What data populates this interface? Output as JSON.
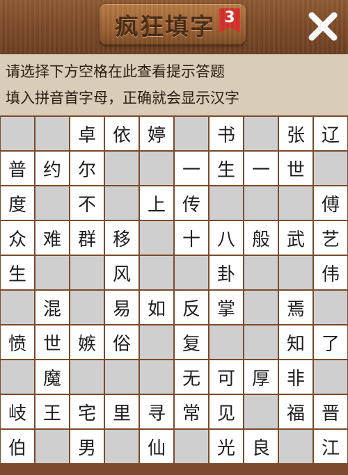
{
  "header": {
    "title": "疯狂填字",
    "level": "3"
  },
  "hints": {
    "line1": "请选择下方空格在此查看提示答题",
    "line2": "填入拼音首字母，正确就会显示汉字"
  },
  "colors": {
    "wood": "#7a4a2a",
    "hint_bg": "#d9cdb9",
    "empty_cell": "#cfcfcf",
    "badge": "#d3312b"
  },
  "icons": {
    "close": "close-icon"
  },
  "grid": [
    [
      "#",
      "#",
      "卓",
      "依",
      "婷",
      "",
      "书",
      "",
      "张",
      "辽"
    ],
    [
      "普",
      "约",
      "尔",
      "",
      "",
      "一",
      "生",
      "一",
      "世",
      ""
    ],
    [
      "度",
      "",
      "不",
      "",
      "上",
      "传",
      "",
      "",
      "",
      "傅"
    ],
    [
      "众",
      "难",
      "群",
      "移",
      "",
      "十",
      "八",
      "般",
      "武",
      "艺"
    ],
    [
      "生",
      "",
      "",
      "风",
      "",
      "",
      "卦",
      "",
      "",
      "伟"
    ],
    [
      "",
      "混",
      "",
      "易",
      "如",
      "反",
      "掌",
      "",
      "焉",
      ""
    ],
    [
      "愤",
      "世",
      "嫉",
      "俗",
      "",
      "复",
      "",
      "",
      "知",
      "了"
    ],
    [
      "",
      "魔",
      "",
      "",
      "",
      "无",
      "可",
      "厚",
      "非",
      ""
    ],
    [
      "岐",
      "王",
      "宅",
      "里",
      "寻",
      "常",
      "见",
      "",
      "福",
      "晋"
    ],
    [
      "伯",
      "",
      "男",
      "",
      "仙",
      "",
      "光",
      "良",
      "",
      "江"
    ]
  ]
}
